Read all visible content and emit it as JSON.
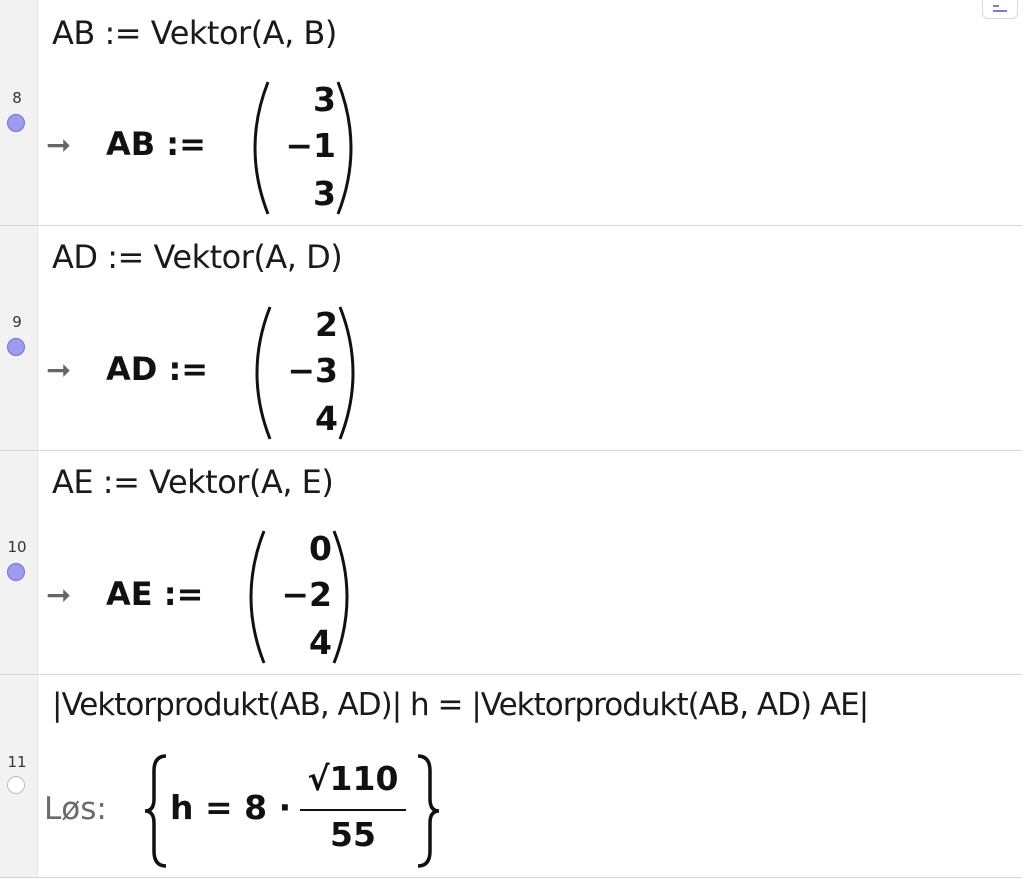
{
  "rows": [
    {
      "number": "8",
      "input": "AB := Vektor(A, B)",
      "output_label": "AB :=",
      "vector": [
        "3",
        "−1",
        "3"
      ],
      "visible": true
    },
    {
      "number": "9",
      "input": "AD := Vektor(A, D)",
      "output_label": "AD :=",
      "vector": [
        "2",
        "−3",
        "4"
      ],
      "visible": true
    },
    {
      "number": "10",
      "input": "AE := Vektor(A, E)",
      "output_label": "AE :=",
      "vector": [
        "0",
        "−2",
        "4"
      ],
      "visible": true
    },
    {
      "number": "11",
      "input": "|Vektorprodukt(AB, AD)| h  =  |Vektorprodukt(AB, AD) AE|",
      "output_prefix": "Løs:",
      "solution": {
        "lhs": "h = 8 ·",
        "numerator": "√110",
        "denominator": "55"
      },
      "visible": false
    }
  ],
  "icons": {
    "output_arrow": "right-arrow-icon",
    "visibility_on": "visibility-dot-icon",
    "visibility_off": "visibility-empty-dot-icon"
  },
  "colors": {
    "dot_fill": "#9d9cf0",
    "gutter": "#f2f2f2",
    "los_label": "#6b6b6b"
  }
}
